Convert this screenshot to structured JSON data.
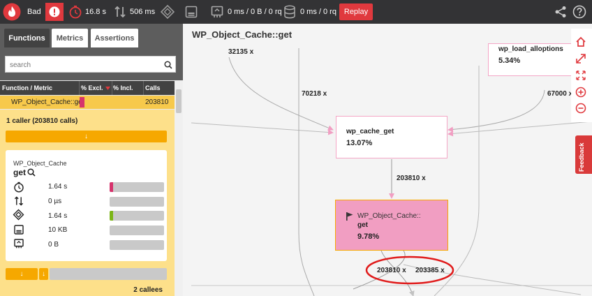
{
  "topbar": {
    "grade": "Bad",
    "wall_time": "16.8 s",
    "io_wait": "506 ms",
    "network": "0 ms / 0 B / 0 rq",
    "sql": "0 ms / 0 rq",
    "replay_label": "Replay"
  },
  "sidebar": {
    "tabs": [
      "Functions",
      "Metrics",
      "Assertions"
    ],
    "search_placeholder": "search",
    "columns": [
      "Function / Metric",
      "% Excl.",
      "% Incl.",
      "Calls"
    ],
    "selected_row": {
      "name": "WP_Object_Cache::get",
      "calls": "203810",
      "excl_pct": 0.1
    },
    "callers_text": "1 caller (203810 calls)",
    "card": {
      "class_name": "WP_Object_Cache",
      "method": "get",
      "metrics": [
        {
          "icon": "clock-icon",
          "value": "1.64 s",
          "fill": 0.06,
          "color": "#d6336c"
        },
        {
          "icon": "io-wait-icon",
          "value": "0 µs",
          "fill": 0,
          "color": "#c9c9c9"
        },
        {
          "icon": "cpu-icon",
          "value": "1.64 s",
          "fill": 0.06,
          "color": "#7cb518"
        },
        {
          "icon": "memory-icon",
          "value": "10 KB",
          "fill": 0,
          "color": "#c9c9c9"
        },
        {
          "icon": "network-icon",
          "value": "0 B",
          "fill": 0,
          "color": "#c9c9c9"
        }
      ]
    },
    "callees_text": "2 callees",
    "arrow_glyph": "↓"
  },
  "graph": {
    "title": "WP_Object_Cache::get",
    "edges": [
      "32135 x",
      "70218 x",
      "67000 x",
      "203810 x",
      "203810 x",
      "203385 x"
    ],
    "nodes": [
      {
        "name": "wp_load_alloptions",
        "pct": "5.34%"
      },
      {
        "name": "wp_cache_get",
        "pct": "13.07%"
      },
      {
        "name_line1": "WP_Object_Cache::",
        "name_line2": "get",
        "pct": "9.78%"
      }
    ]
  },
  "feedback_label": "Feedback",
  "colors": {
    "topbar": "#333335",
    "accent_red": "#e0393e",
    "selected_node": "#f19ec2",
    "node_border_pink": "#f4a6c6",
    "highlight_orange": "#f6a800"
  }
}
